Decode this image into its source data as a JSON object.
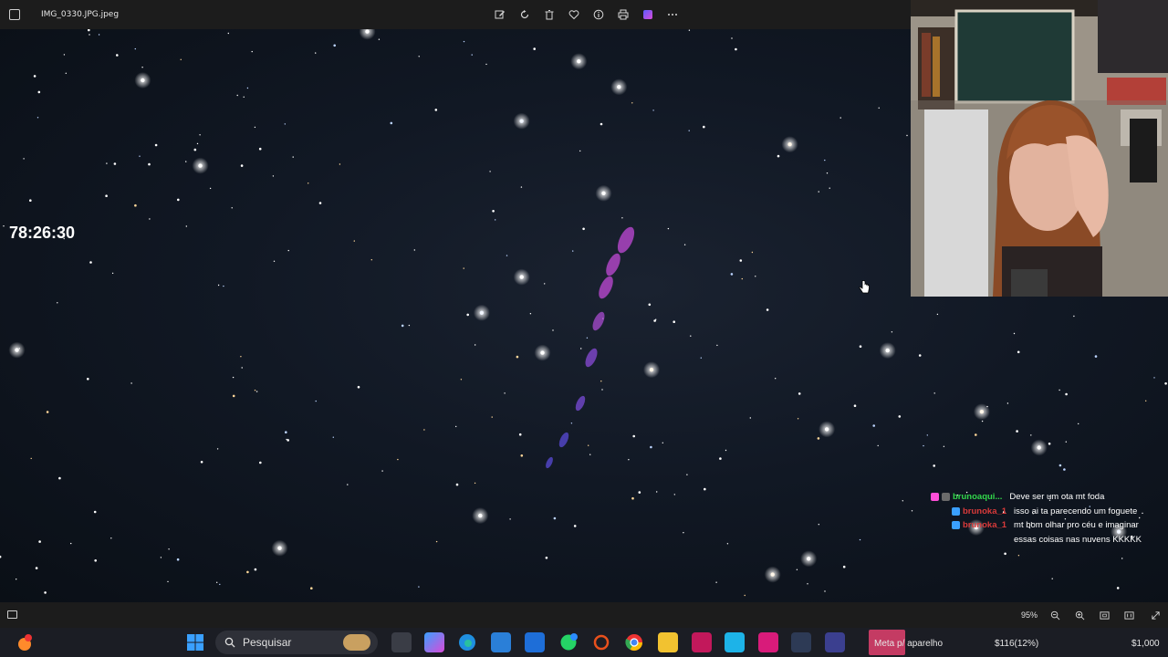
{
  "window": {
    "title": "IMG_0330.JPG.jpeg"
  },
  "toolbar": {
    "tools": [
      {
        "name": "edit-icon"
      },
      {
        "name": "rotate-icon"
      },
      {
        "name": "delete-icon"
      },
      {
        "name": "favorite-icon"
      },
      {
        "name": "info-icon"
      },
      {
        "name": "print-icon"
      },
      {
        "name": "designer-icon"
      },
      {
        "name": "more-icon"
      }
    ]
  },
  "overlay": {
    "timer": "78:26:30"
  },
  "chat": {
    "messages": [
      {
        "user": "brunoaqui...",
        "user_color": "#32d74b",
        "badge_color": "#ff4fd8",
        "text": "Deve ser um ota mt foda",
        "text_cont": ""
      },
      {
        "user": "brunoka_1",
        "user_color": "#d93a3a",
        "badge_color": "#3aa0ff",
        "text": "isso ai ta parecendo um foguete",
        "text_cont": ""
      },
      {
        "user": "brunoka_1",
        "user_color": "#d93a3a",
        "badge_color": "#3aa0ff",
        "text": "mt bom olhar pro céu e imaginar",
        "text_cont": "essas coisas nas nuvens KKKKK"
      }
    ]
  },
  "statusbar": {
    "zoom": "95%"
  },
  "taskbar": {
    "search_placeholder": "Pesquisar",
    "tray_app": "Meta p/ aparelho",
    "tray_amount": "$116(12%)",
    "tray_goal": "$1,000"
  },
  "colors": {
    "sky": "#0d121a",
    "comet_magenta": "#c24ad8",
    "comet_blue": "#5a4bd8"
  }
}
